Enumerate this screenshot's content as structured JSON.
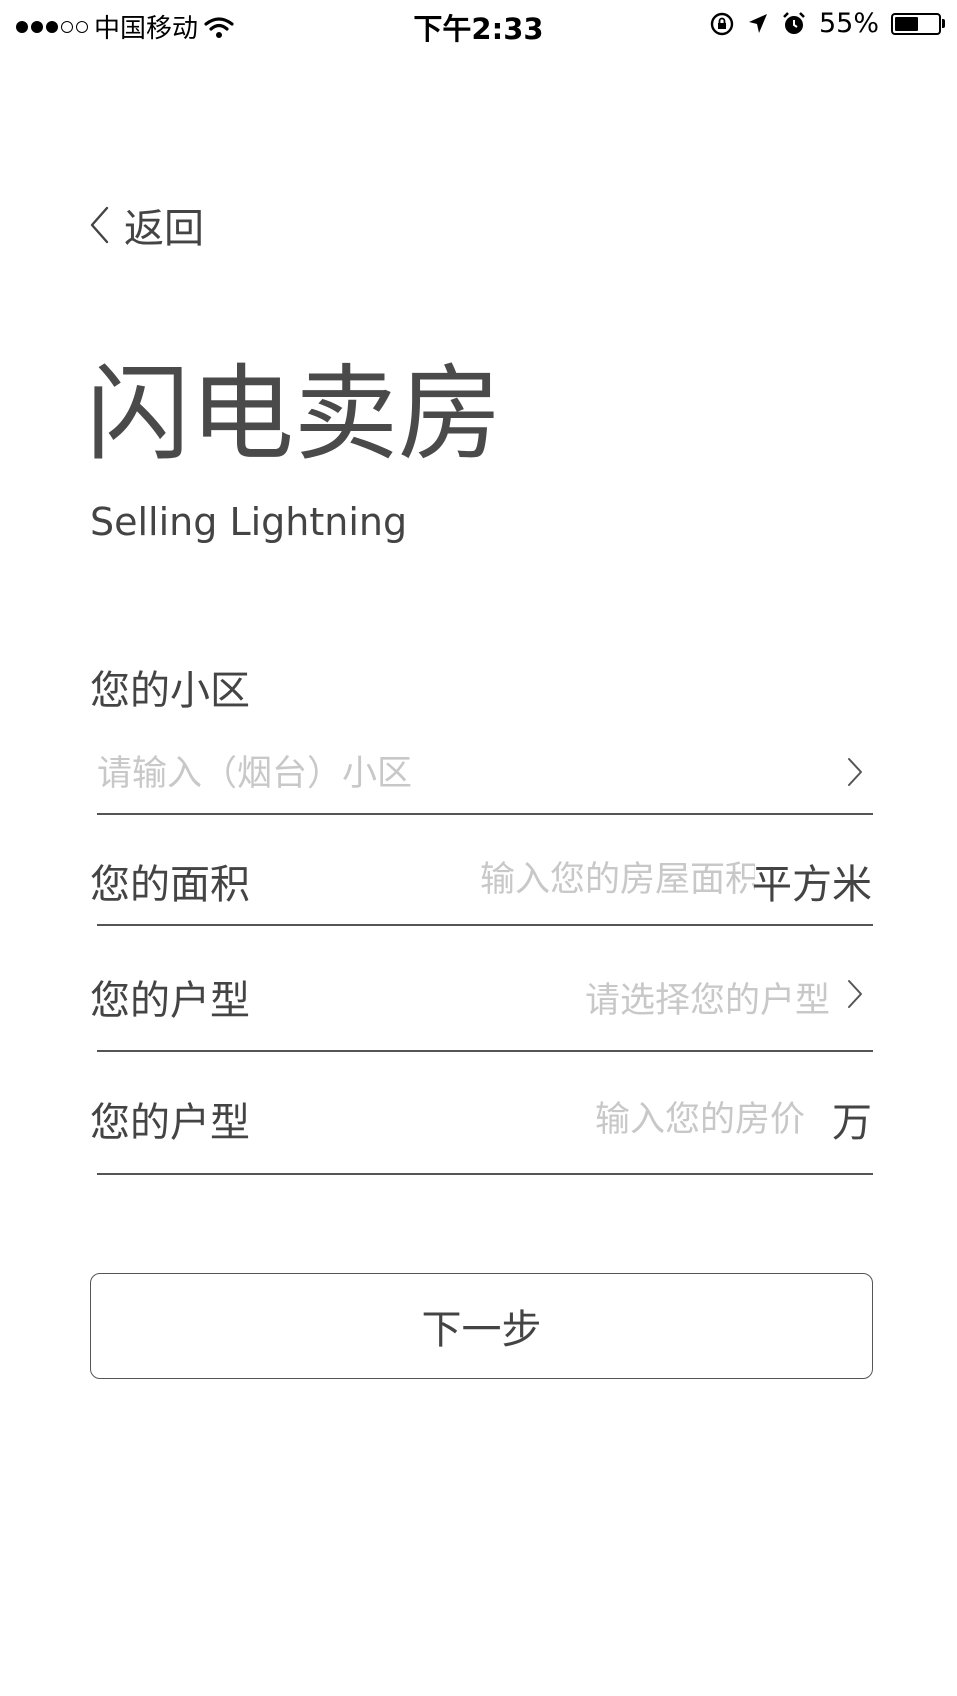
{
  "status_bar": {
    "carrier": "中国移动",
    "time": "下午2:33",
    "battery_text": "55%",
    "battery_level": 0.55,
    "signal_bars_filled": 3,
    "signal_bars_total": 5,
    "icons": [
      "wifi-icon",
      "orientation-lock-icon",
      "location-arrow-icon",
      "alarm-icon",
      "battery-icon"
    ]
  },
  "nav": {
    "back_label": "返回",
    "back_icon": "chevron-left-icon"
  },
  "header": {
    "title": "闪电卖房",
    "subtitle": "Selling Lightning"
  },
  "form": {
    "community": {
      "label": "您的小区",
      "placeholder": "请输入（烟台）小区",
      "icon": "chevron-right-icon"
    },
    "area": {
      "label": "您的面积",
      "placeholder": "输入您的房屋面积",
      "unit": "平方米"
    },
    "layout": {
      "label": "您的户型",
      "placeholder": "请选择您的户型",
      "icon": "chevron-right-icon"
    },
    "price": {
      "label": "您的户型",
      "placeholder": "输入您的房价",
      "unit": "万"
    }
  },
  "actions": {
    "next_label": "下一步"
  },
  "colors": {
    "text": "#444444",
    "placeholder": "#c8c8c8",
    "divider": "#555555",
    "background": "#ffffff"
  }
}
